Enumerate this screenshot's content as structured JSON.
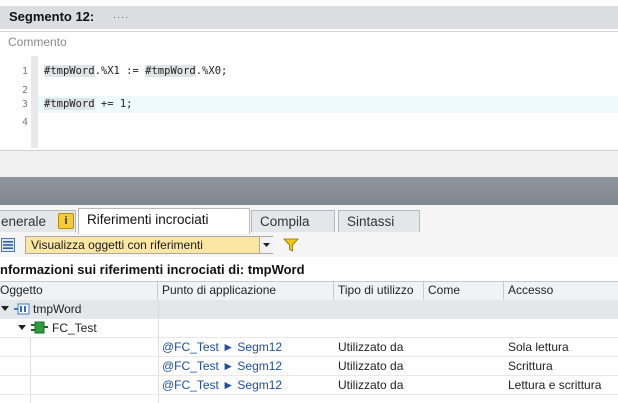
{
  "segment": {
    "title": "Segmento 12:",
    "dots": "....",
    "comment_placeholder": "Commento"
  },
  "code": {
    "lines": [
      {
        "num": "1",
        "var1": "#tmpWord",
        "rest1": ".%X1 := ",
        "var2": "#tmpWord",
        "rest2": ".%X0;"
      },
      {
        "num": "2"
      },
      {
        "num": "3",
        "var1": "#tmpWord",
        "rest1": " += 1;"
      },
      {
        "num": "4"
      }
    ]
  },
  "tabs": [
    {
      "label": "enerale",
      "active": false
    },
    {
      "label": "Riferimenti incrociati",
      "active": true
    },
    {
      "label": "Compila",
      "active": false
    },
    {
      "label": "Sintassi",
      "active": false
    }
  ],
  "toolbar": {
    "filter_value": "Visualizza oggetti con riferimenti"
  },
  "section_title": "nformazioni sui riferimenti incrociati di: tmpWord",
  "table": {
    "columns": [
      "Oggetto",
      "Punto di applicazione",
      "Tipo di utilizzo",
      "Come",
      "Accesso"
    ],
    "tree": [
      {
        "label": "tmpWord",
        "icon": "variable-icon"
      },
      {
        "label": "FC_Test",
        "icon": "function-block-icon"
      }
    ],
    "rows": [
      {
        "punto": "@FC_Test ► Segm12",
        "tipo": "Utilizzato da",
        "come": "",
        "accesso": "Sola lettura"
      },
      {
        "punto": "@FC_Test ► Segm12",
        "tipo": "Utilizzato da",
        "come": "",
        "accesso": "Scrittura"
      },
      {
        "punto": "@FC_Test ► Segm12",
        "tipo": "Utilizzato da",
        "come": "",
        "accesso": "Lettura e scrittura"
      }
    ]
  },
  "colors": {
    "accent_select": "#fbe7a3",
    "link": "#1f4ea3",
    "dark_bar": "#8a9198"
  }
}
